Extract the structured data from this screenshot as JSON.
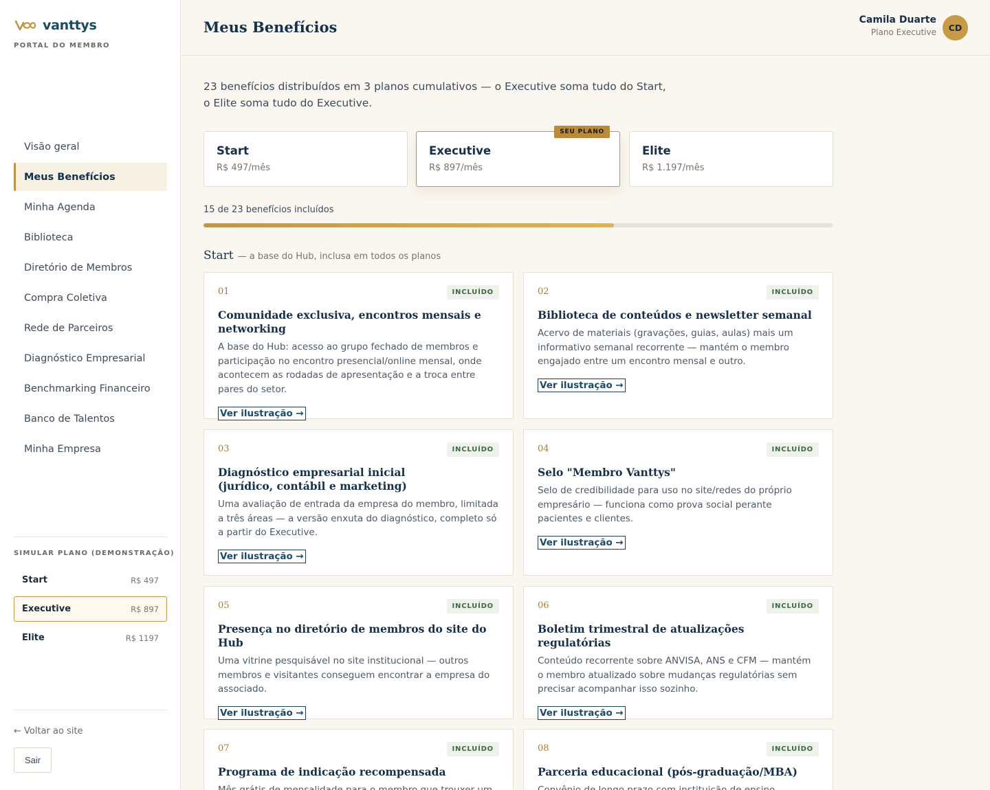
{
  "brand": {
    "name": "vanttys",
    "subtitle": "PORTAL DO MEMBRO",
    "gold": "#c09645",
    "navy": "#16304a"
  },
  "sidebar": {
    "items": [
      {
        "label": "Visão geral",
        "active": false
      },
      {
        "label": "Meus Benefícios",
        "active": true
      },
      {
        "label": "Minha Agenda",
        "active": false
      },
      {
        "label": "Biblioteca",
        "active": false
      },
      {
        "label": "Diretório de Membros",
        "active": false
      },
      {
        "label": "Compra Coletiva",
        "active": false
      },
      {
        "label": "Rede de Parceiros",
        "active": false
      },
      {
        "label": "Diagnóstico Empresarial",
        "active": false
      },
      {
        "label": "Benchmarking Financeiro",
        "active": false
      },
      {
        "label": "Banco de Talentos",
        "active": false
      },
      {
        "label": "Minha Empresa",
        "active": false
      }
    ],
    "simulate": {
      "title": "SIMULAR PLANO (DEMONSTRAÇÃO)",
      "plans": [
        {
          "name": "Start",
          "price": "R$ 497",
          "active": false
        },
        {
          "name": "Executive",
          "price": "R$ 897",
          "active": true
        },
        {
          "name": "Elite",
          "price": "R$ 1197",
          "active": false
        }
      ]
    },
    "back_label": "← Voltar ao site",
    "logout_label": "Sair"
  },
  "header": {
    "title": "Meus Benefícios",
    "user": {
      "name": "Camila Duarte",
      "plan": "Plano Executive",
      "initials": "CD"
    }
  },
  "main": {
    "intro": "23 benefícios distribuídos em 3 planos cumulativos — o Executive soma tudo do Start, o Elite soma tudo do Executive.",
    "plans": [
      {
        "name": "Start",
        "price": "R$ 497/mês",
        "current": false
      },
      {
        "name": "Executive",
        "price": "R$ 897/mês",
        "current": true,
        "badge": "SEU PLANO"
      },
      {
        "name": "Elite",
        "price": "R$ 1.197/mês",
        "current": false
      }
    ],
    "progress": {
      "label": "15 de 23 benefícios incluídos",
      "included": 15,
      "total": 23
    },
    "section": {
      "title": "Start",
      "subtitle": "— a base do Hub, inclusa em todos os planos"
    },
    "link_label": "Ver ilustração →",
    "badge_label": "INCLUÍDO",
    "benefits": [
      {
        "num": "01",
        "title": "Comunidade exclusiva, encontros mensais e networking",
        "desc": "A base do Hub: acesso ao grupo fechado de membros e participação no encontro presencial/online mensal, onde acontecem as rodadas de apresentação e a troca entre pares do setor."
      },
      {
        "num": "02",
        "title": "Biblioteca de conteúdos e newsletter semanal",
        "desc": "Acervo de materiais (gravações, guias, aulas) mais um informativo semanal recorrente — mantém o membro engajado entre um encontro mensal e outro."
      },
      {
        "num": "03",
        "title": "Diagnóstico empresarial inicial\n(jurídico, contábil e marketing)",
        "desc": "Uma avaliação de entrada da empresa do membro, limitada a três áreas — a versão enxuta do diagnóstico, completo só a partir do Executive."
      },
      {
        "num": "04",
        "title": "Selo \"Membro Vanttys\"",
        "desc": "Selo de credibilidade para uso no site/redes do próprio empresário — funciona como prova social perante pacientes e clientes."
      },
      {
        "num": "05",
        "title": "Presença no diretório de membros do site do Hub",
        "desc": "Uma vitrine pesquisável no site institucional — outros membros e visitantes conseguem encontrar a empresa do associado."
      },
      {
        "num": "06",
        "title": "Boletim trimestral de atualizações regulatórias",
        "desc": "Conteúdo recorrente sobre ANVISA, ANS e CFM — mantém o membro atualizado sobre mudanças regulatórias sem precisar acompanhar isso sozinho."
      },
      {
        "num": "07",
        "title": "Programa de indicação recompensada",
        "desc": "Mês grátis de mensalidade para o membro que trouxer um"
      },
      {
        "num": "08",
        "title": "Parceria educacional (pós-graduação/MBA)",
        "desc": "Convênio de longo prazo com instituição de ensino —"
      }
    ]
  }
}
